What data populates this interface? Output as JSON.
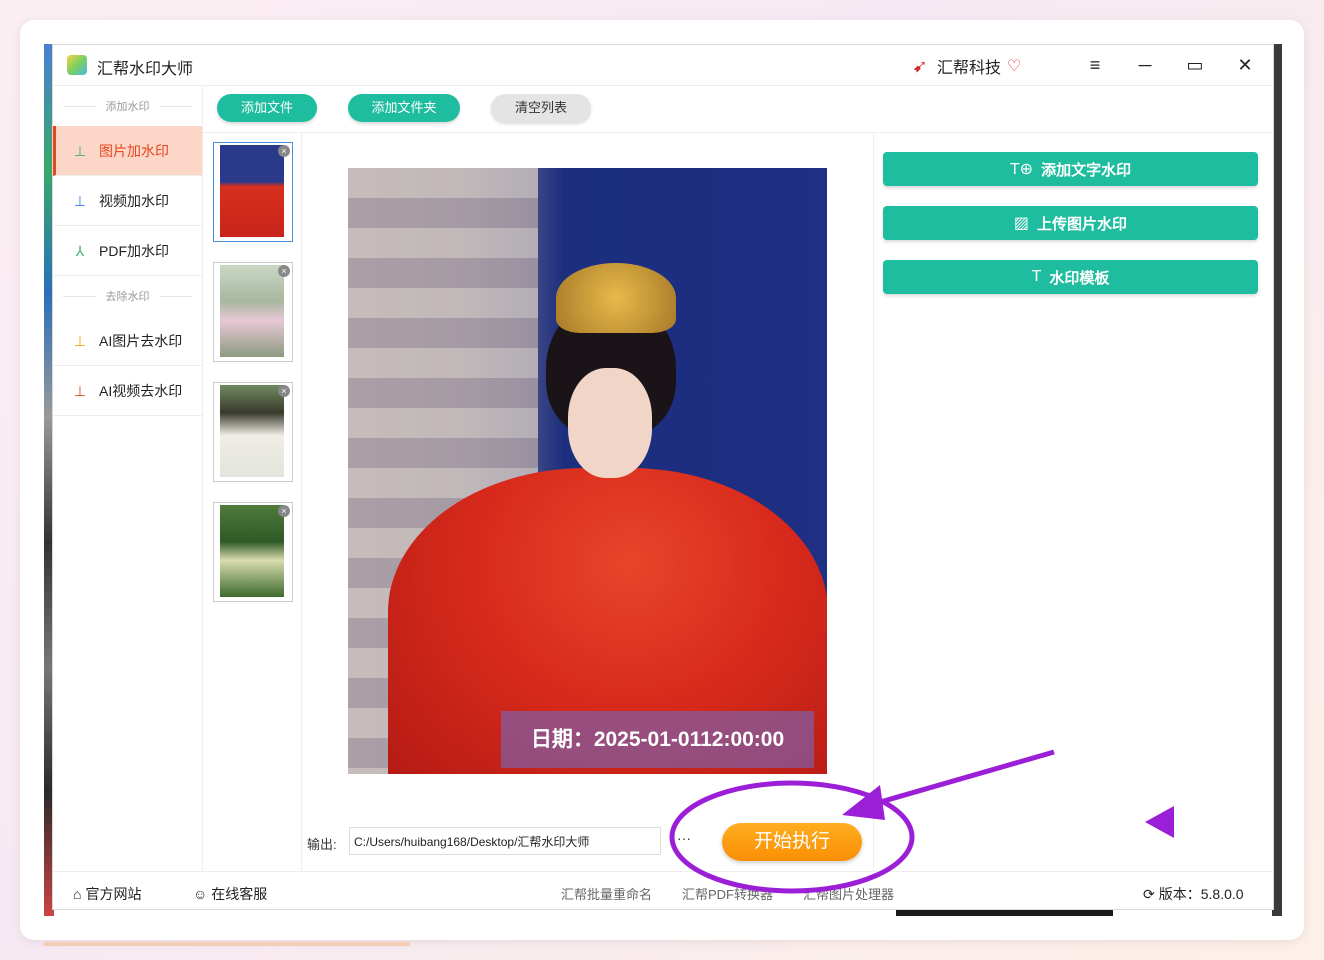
{
  "titlebar": {
    "app_title": "汇帮水印大师",
    "brand": "汇帮科技",
    "menu_icon": "≡",
    "minimize_icon": "─",
    "maximize_icon": "▭",
    "close_icon": "✕"
  },
  "toolbar": {
    "add_file": "添加文件",
    "add_folder": "添加文件夹",
    "clear_list": "清空列表"
  },
  "sidebar": {
    "section_add": "添加水印",
    "section_remove": "去除水印",
    "items": [
      {
        "label": "图片加水印",
        "active": true
      },
      {
        "label": "视频加水印",
        "active": false
      },
      {
        "label": "PDF加水印",
        "active": false
      },
      {
        "label": "AI图片去水印",
        "active": false
      },
      {
        "label": "AI视频去水印",
        "active": false
      }
    ]
  },
  "preview": {
    "watermark_text": "日期：2025-01-0112:00:00"
  },
  "output": {
    "label": "输出:",
    "path": "C:/Users/huibang168/Desktop/汇帮水印大师",
    "browse": "···"
  },
  "actions": {
    "start": "开始执行"
  },
  "right_panel": {
    "add_text_watermark": "添加文字水印",
    "upload_image_watermark": "上传图片水印",
    "watermark_template": "水印模板"
  },
  "statusbar": {
    "official_site": "官方网站",
    "online_service": "在线客服",
    "batch_rename": "汇帮批量重命名",
    "pdf_converter": "汇帮PDF转换器",
    "image_processor": "汇帮图片处理器",
    "version": "版本：5.8.0.0"
  },
  "colors": {
    "accent_green": "#1fbd9f",
    "active_orange": "#e8461f",
    "start_orange": "#fb8f05",
    "annotation_purple": "#9b1fd6"
  }
}
